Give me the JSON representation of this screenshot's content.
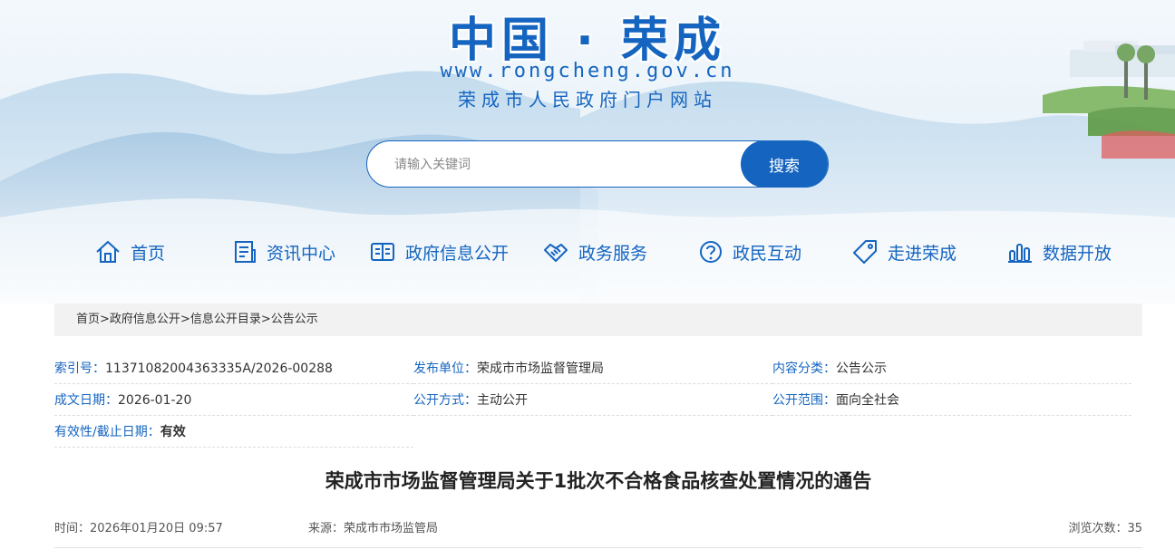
{
  "header": {
    "title": "中国 · 荣成",
    "url": "www.rongcheng.gov.cn",
    "subtitle": "荣成市人民政府门户网站"
  },
  "search": {
    "placeholder": "请输入关键词",
    "button_label": "搜索"
  },
  "nav": {
    "items": [
      {
        "label": "首页",
        "icon": "home-icon"
      },
      {
        "label": "资讯中心",
        "icon": "news-icon"
      },
      {
        "label": "政府信息公开",
        "icon": "book-icon"
      },
      {
        "label": "政务服务",
        "icon": "handshake-icon"
      },
      {
        "label": "政民互动",
        "icon": "question-icon"
      },
      {
        "label": "走进荣成",
        "icon": "tag-icon"
      },
      {
        "label": "数据开放",
        "icon": "bar-chart-icon"
      }
    ]
  },
  "breadcrumb": {
    "items": [
      "首页",
      "政府信息公开",
      "信息公开目录",
      "公告公示"
    ],
    "separator": ">"
  },
  "meta": {
    "index_no": {
      "key": "索引号：",
      "value": "11371082004363335A/2026-00288"
    },
    "publisher": {
      "key": "发布单位：",
      "value": "荣成市市场监督管理局"
    },
    "category": {
      "key": "内容分类：",
      "value": "公告公示"
    },
    "date": {
      "key": "成文日期：",
      "value": "2026-01-20"
    },
    "open_mode": {
      "key": "公开方式：",
      "value": "主动公开"
    },
    "open_scope": {
      "key": "公开范围：",
      "value": "面向全社会"
    },
    "validity": {
      "key": "有效性/截止日期：",
      "value": "有效"
    }
  },
  "article": {
    "title": "荣成市市场监督管理局关于1批次不合格食品核查处置情况的通告",
    "time": "时间：2026年01月20日 09:57",
    "source": "来源：荣成市市场监管局",
    "views": "浏览次数：35"
  },
  "colors": {
    "accent": "#1565c0",
    "breadcrumb_bg": "#f2f2f2"
  }
}
